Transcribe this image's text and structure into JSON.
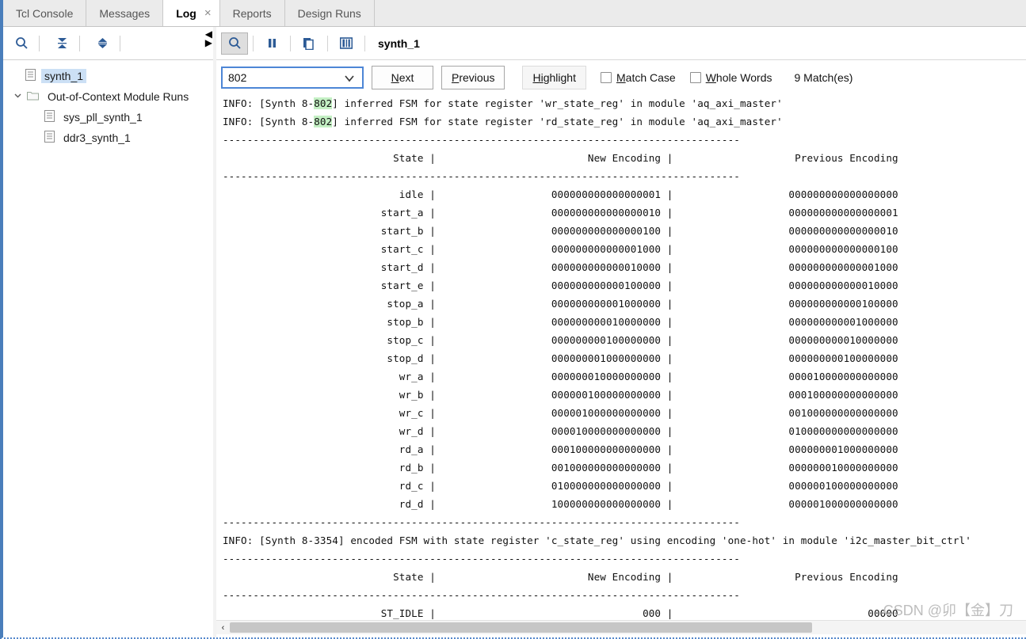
{
  "window": {
    "accent_color": "#4a7ebb",
    "highlight_color": "#c4f0c4",
    "selection_color": "#cce0f5"
  },
  "tabs": [
    {
      "label": "Tcl Console",
      "active": false,
      "closable": false
    },
    {
      "label": "Messages",
      "active": false,
      "closable": false
    },
    {
      "label": "Log",
      "active": true,
      "closable": true
    },
    {
      "label": "Reports",
      "active": false,
      "closable": false
    },
    {
      "label": "Design Runs",
      "active": false,
      "closable": false
    }
  ],
  "tab_close_glyph": "×",
  "left_toolbar": {
    "icons": [
      {
        "name": "search-icon",
        "glyph": "search"
      },
      {
        "name": "collapse-all-icon",
        "glyph": "collapse"
      },
      {
        "name": "expand-all-icon",
        "glyph": "expand"
      }
    ],
    "scroll_left_glyph": "◀",
    "scroll_right_glyph": "▶"
  },
  "tree": {
    "items": [
      {
        "label": "synth_1",
        "icon": "document-icon",
        "indent": 1,
        "selected": true,
        "twisty": ""
      },
      {
        "label": "Out-of-Context Module Runs",
        "icon": "folder-icon",
        "indent": 0,
        "selected": false,
        "twisty": "⌄"
      },
      {
        "label": "sys_pll_synth_1",
        "icon": "document-icon",
        "indent": 2,
        "selected": false,
        "twisty": ""
      },
      {
        "label": "ddr3_synth_1",
        "icon": "document-icon",
        "indent": 2,
        "selected": false,
        "twisty": ""
      }
    ]
  },
  "find_toolbar": {
    "buttons": [
      {
        "name": "find-toggle-button",
        "glyph": "search",
        "pressed": true
      },
      {
        "name": "pause-button",
        "glyph": "pause",
        "pressed": false
      },
      {
        "name": "copy-button",
        "glyph": "copy",
        "pressed": false
      },
      {
        "name": "columns-button",
        "glyph": "columns",
        "pressed": false
      }
    ],
    "title": "synth_1"
  },
  "search": {
    "value": "802",
    "placeholder": "",
    "dropdown_glyph": "⌄",
    "next_label_prefix": "",
    "next_accel": "N",
    "next_rest": "ext",
    "previous_accel": "P",
    "previous_rest": "revious",
    "highlight_accel": "Hi",
    "highlight_rest": "ghlight",
    "match_case_accel": "M",
    "match_case_rest": "atch Case",
    "match_case_checked": false,
    "whole_words_accel": "W",
    "whole_words_rest": "hole Words",
    "whole_words_checked": false,
    "match_count": "9 Match(es)"
  },
  "log": {
    "divider": "-------------------------------------------------------------------------------------",
    "lines_top": [
      {
        "pre": "INFO: [Synth 8-",
        "hl": "802",
        "post": "] inferred FSM for state register 'wr_state_reg' in module 'aq_axi_master'"
      },
      {
        "pre": "INFO: [Synth 8-",
        "hl": "802",
        "post": "] inferred FSM for state register 'rd_state_reg' in module 'aq_axi_master'"
      }
    ],
    "table1": {
      "header": {
        "state": "State",
        "new_encoding": "New Encoding",
        "previous_encoding": "Previous Encoding"
      },
      "rows": [
        {
          "state": "idle",
          "new": "000000000000000001",
          "prev": "000000000000000000"
        },
        {
          "state": "start_a",
          "new": "000000000000000010",
          "prev": "000000000000000001"
        },
        {
          "state": "start_b",
          "new": "000000000000000100",
          "prev": "000000000000000010"
        },
        {
          "state": "start_c",
          "new": "000000000000001000",
          "prev": "000000000000000100"
        },
        {
          "state": "start_d",
          "new": "000000000000010000",
          "prev": "000000000000001000"
        },
        {
          "state": "start_e",
          "new": "000000000000100000",
          "prev": "000000000000010000"
        },
        {
          "state": "stop_a",
          "new": "000000000001000000",
          "prev": "000000000000100000"
        },
        {
          "state": "stop_b",
          "new": "000000000010000000",
          "prev": "000000000001000000"
        },
        {
          "state": "stop_c",
          "new": "000000000100000000",
          "prev": "000000000010000000"
        },
        {
          "state": "stop_d",
          "new": "000000001000000000",
          "prev": "000000000100000000"
        },
        {
          "state": "wr_a",
          "new": "000000010000000000",
          "prev": "000010000000000000"
        },
        {
          "state": "wr_b",
          "new": "000000100000000000",
          "prev": "000100000000000000"
        },
        {
          "state": "wr_c",
          "new": "000001000000000000",
          "prev": "001000000000000000"
        },
        {
          "state": "wr_d",
          "new": "000010000000000000",
          "prev": "010000000000000000"
        },
        {
          "state": "rd_a",
          "new": "000100000000000000",
          "prev": "000000001000000000"
        },
        {
          "state": "rd_b",
          "new": "001000000000000000",
          "prev": "000000010000000000"
        },
        {
          "state": "rd_c",
          "new": "010000000000000000",
          "prev": "000000100000000000"
        },
        {
          "state": "rd_d",
          "new": "100000000000000000",
          "prev": "000001000000000000"
        }
      ]
    },
    "line_mid": "INFO: [Synth 8-3354] encoded FSM with state register 'c_state_reg' using encoding 'one-hot' in module 'i2c_master_bit_ctrl'",
    "table2": {
      "header": {
        "state": "State",
        "new_encoding": "New Encoding",
        "previous_encoding": "Previous Encoding"
      },
      "rows": [
        {
          "state": "ST_IDLE",
          "new": "000",
          "prev": "00000"
        }
      ]
    }
  },
  "hscroll": {
    "left_arrow_glyph": "‹"
  },
  "watermark": "CSDN @卯【金】刀"
}
